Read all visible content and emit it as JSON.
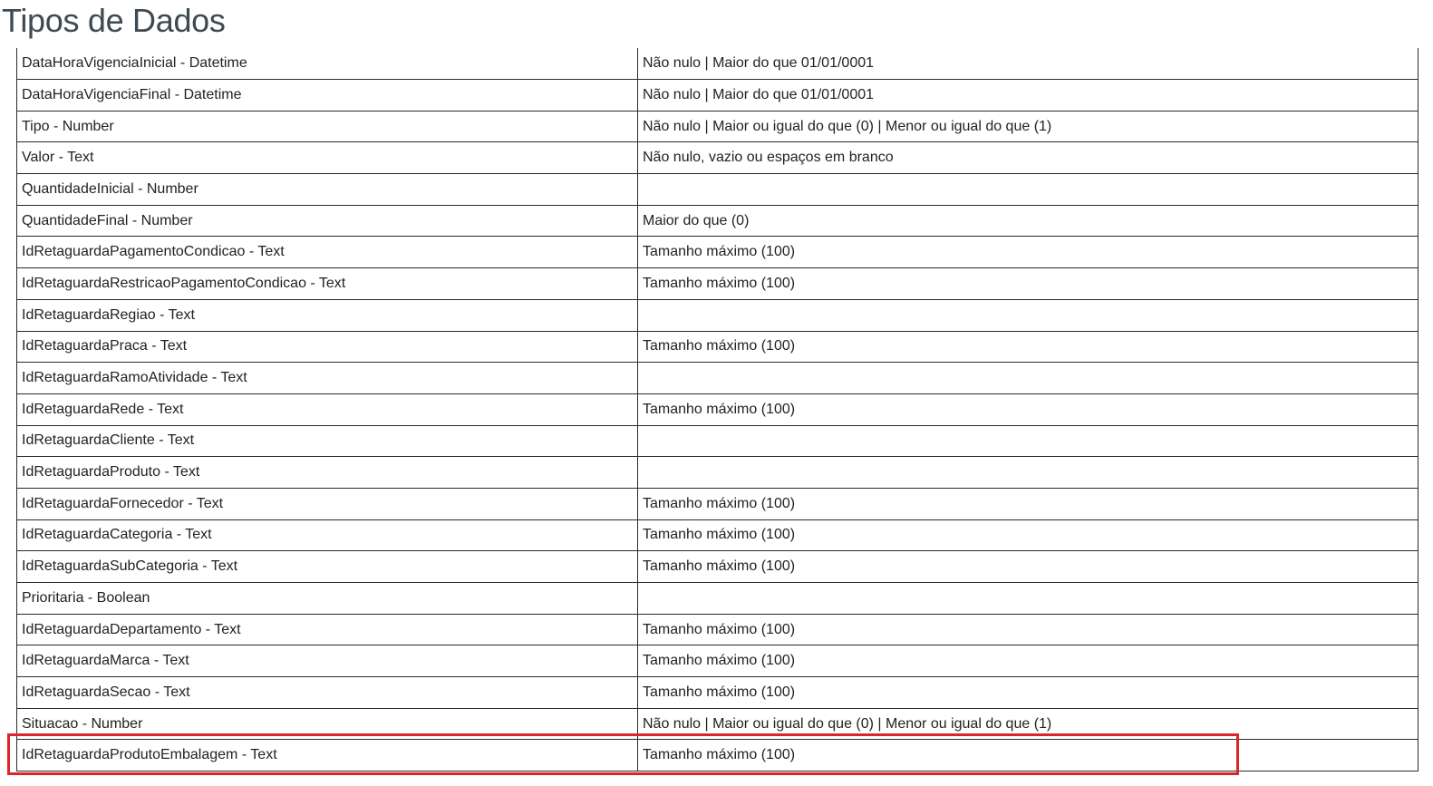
{
  "page": {
    "title": "Tipos de Dados"
  },
  "table": {
    "rows": [
      {
        "field": "DataHoraVigenciaInicial - Datetime",
        "rule": "Não nulo | Maior do que 01/01/0001"
      },
      {
        "field": "DataHoraVigenciaFinal - Datetime",
        "rule": "Não nulo | Maior do que 01/01/0001"
      },
      {
        "field": "Tipo - Number",
        "rule": "Não nulo | Maior ou igual do que (0) | Menor ou igual do que (1)"
      },
      {
        "field": "Valor - Text",
        "rule": "Não nulo, vazio ou espaços em branco"
      },
      {
        "field": "QuantidadeInicial - Number",
        "rule": ""
      },
      {
        "field": "QuantidadeFinal - Number",
        "rule": "Maior do que (0)"
      },
      {
        "field": "IdRetaguardaPagamentoCondicao - Text",
        "rule": "Tamanho máximo (100)"
      },
      {
        "field": "IdRetaguardaRestricaoPagamentoCondicao - Text",
        "rule": "Tamanho máximo (100)"
      },
      {
        "field": "IdRetaguardaRegiao - Text",
        "rule": ""
      },
      {
        "field": "IdRetaguardaPraca - Text",
        "rule": "Tamanho máximo (100)"
      },
      {
        "field": "IdRetaguardaRamoAtividade - Text",
        "rule": ""
      },
      {
        "field": "IdRetaguardaRede - Text",
        "rule": "Tamanho máximo (100)"
      },
      {
        "field": "IdRetaguardaCliente - Text",
        "rule": ""
      },
      {
        "field": "IdRetaguardaProduto - Text",
        "rule": ""
      },
      {
        "field": "IdRetaguardaFornecedor - Text",
        "rule": "Tamanho máximo (100)"
      },
      {
        "field": "IdRetaguardaCategoria - Text",
        "rule": "Tamanho máximo (100)"
      },
      {
        "field": "IdRetaguardaSubCategoria - Text",
        "rule": "Tamanho máximo (100)"
      },
      {
        "field": "Prioritaria - Boolean",
        "rule": ""
      },
      {
        "field": "IdRetaguardaDepartamento - Text",
        "rule": "Tamanho máximo (100)"
      },
      {
        "field": "IdRetaguardaMarca - Text",
        "rule": "Tamanho máximo (100)"
      },
      {
        "field": "IdRetaguardaSecao - Text",
        "rule": "Tamanho máximo (100)"
      },
      {
        "field": "Situacao - Number",
        "rule": "Não nulo | Maior ou igual do que (0) | Menor ou igual do que (1)"
      },
      {
        "field": "IdRetaguardaProdutoEmbalagem - Text",
        "rule": "Tamanho máximo (100)"
      }
    ]
  },
  "highlight": {
    "row": 22,
    "color": "#d9262b"
  }
}
